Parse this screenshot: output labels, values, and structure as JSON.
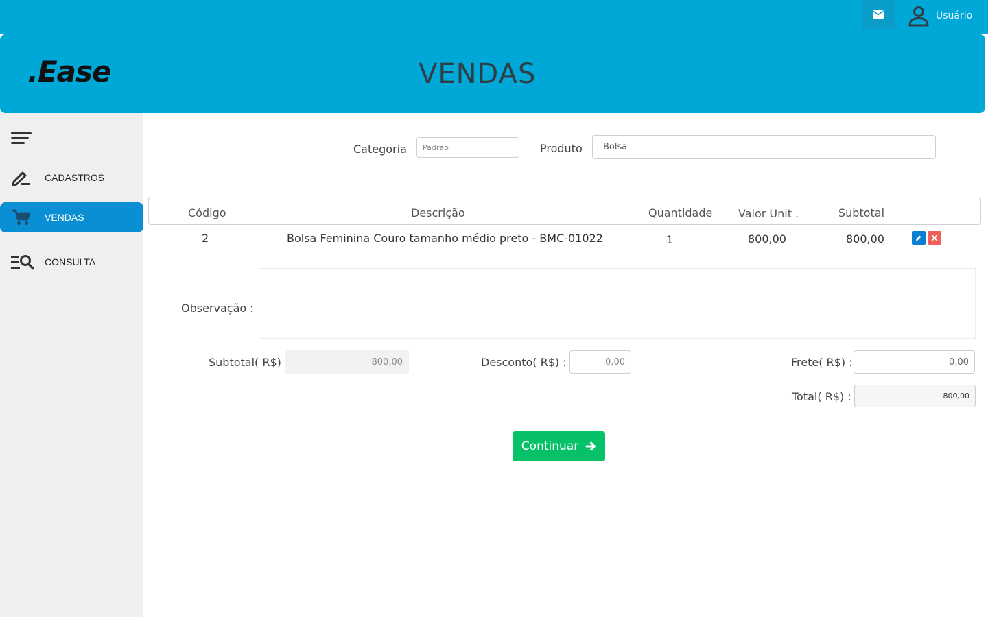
{
  "topbar": {
    "user_label": "Usuário",
    "accent": "#00a8d7"
  },
  "header": {
    "logo": ".Ease",
    "title": "VENDAS"
  },
  "sidebar": {
    "items": [
      {
        "label": "CADASTROS",
        "icon": "edit-pen-icon",
        "active": false
      },
      {
        "label": "VENDAS",
        "icon": "cart-icon",
        "active": true
      },
      {
        "label": "CONSULTA",
        "icon": "list-search-icon",
        "active": false
      }
    ]
  },
  "filters": {
    "category_label": "Categoria",
    "category_value": "Padrão",
    "product_label": "Produto",
    "product_value": "Bolsa"
  },
  "table": {
    "headers": [
      "Código",
      "Descrição",
      "Quantidade",
      "Valor Unit .",
      "Subtotal"
    ],
    "rows": [
      {
        "code": "2",
        "description": "Bolsa Feminina Couro tamanho médio preto - BMC-01022",
        "qty": "1",
        "unit": "800,00",
        "subtotal": "800,00"
      }
    ]
  },
  "form": {
    "obs_label": "Observação :",
    "subtotal_label": "Subtotal( R$) :",
    "subtotal_value": "800,00",
    "discount_label": "Desconto( R$) :",
    "discount_value": "0,00",
    "freight_label": "Frete( R$) :",
    "freight_value": "0,00",
    "total_label": "Total( R$) :",
    "total_value": "800,00"
  },
  "actions": {
    "continue_label": "Continuar"
  }
}
